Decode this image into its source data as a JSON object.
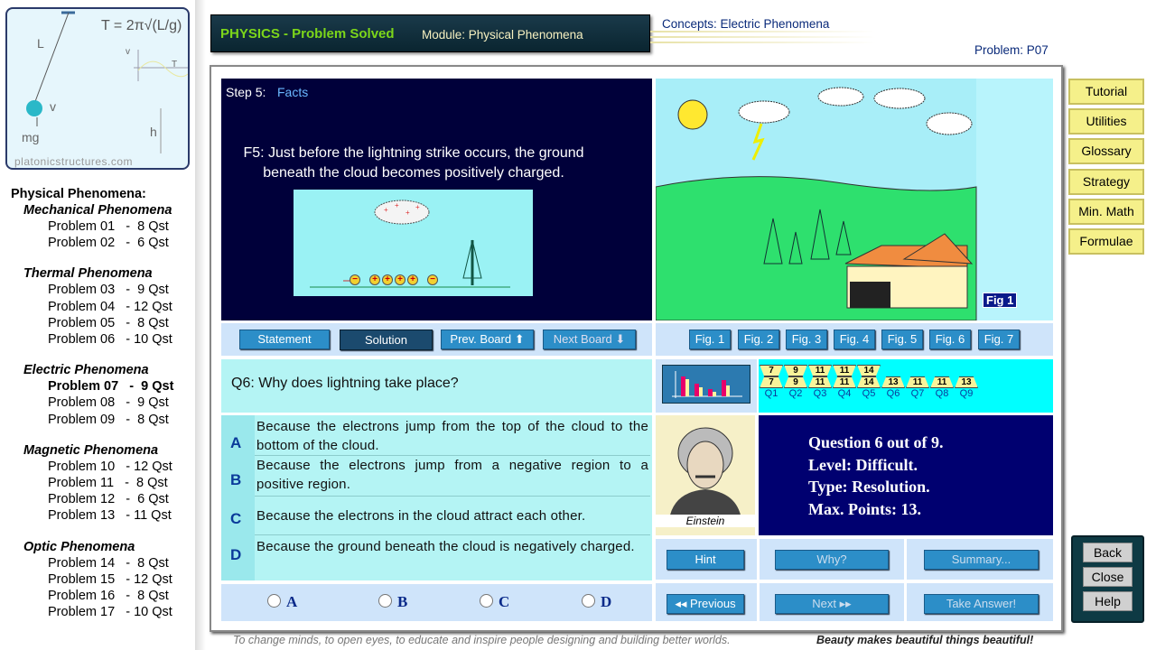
{
  "logo": {
    "formula": "T = 2π√(L/g)",
    "labels": [
      "L",
      "v",
      "mg",
      "h",
      "v",
      "T"
    ],
    "site": "platonicstructures.com"
  },
  "sidebar": {
    "title": "Physical Phenomena:",
    "groups": [
      {
        "name": "Mechanical Phenomena",
        "items": [
          "Problem 01   -  8 Qst",
          "Problem 02   -  6 Qst"
        ]
      },
      {
        "name": "Thermal Phenomena",
        "items": [
          "Problem 03   -  9 Qst",
          "Problem 04   - 12 Qst",
          "Problem 05   -  8 Qst",
          "Problem 06   - 10 Qst"
        ]
      },
      {
        "name": "Electric Phenomena",
        "items": [
          "Problem 07   -  9 Qst",
          "Problem 08   -  9 Qst",
          "Problem 09   -  8 Qst"
        ]
      },
      {
        "name": "Magnetic Phenomena",
        "items": [
          "Problem 10   - 12 Qst",
          "Problem 11   -  8 Qst",
          "Problem 12   -  6 Qst",
          "Problem 13   - 11 Qst"
        ]
      },
      {
        "name": "Optic Phenomena",
        "items": [
          "Problem 14   -  8 Qst",
          "Problem 15   - 12 Qst",
          "Problem 16   -  8 Qst",
          "Problem 17   - 10 Qst"
        ]
      }
    ],
    "current": "Problem 07"
  },
  "header": {
    "title": "PHYSICS - Problem Solved",
    "module": "Module: Physical Phenomena",
    "concepts": "Concepts: Electric Phenomena",
    "problem": "Problem: P07"
  },
  "board": {
    "step": "Step 5:",
    "step_name": "Facts",
    "fact": "F5: Just before the lightning strike occurs, the ground beneath the cloud becomes positively charged.",
    "charges": [
      "−",
      "+",
      "+",
      "+",
      "+",
      "−"
    ]
  },
  "figure": {
    "label": "Fig 1"
  },
  "board_buttons": [
    "Statement",
    "Solution",
    "Prev. Board ⬆",
    "Next Board ⬇"
  ],
  "fig_buttons": [
    "Fig. 1",
    "Fig. 2",
    "Fig. 3",
    "Fig. 4",
    "Fig. 5",
    "Fig. 6",
    "Fig. 7"
  ],
  "question": "Q6: Why does lightning take place?",
  "question_scores": [
    {
      "q": "Q1",
      "top": "7",
      "bottom": "7"
    },
    {
      "q": "Q2",
      "top": "9",
      "bottom": "9"
    },
    {
      "q": "Q3",
      "top": "11",
      "bottom": "11"
    },
    {
      "q": "Q4",
      "top": "11",
      "bottom": "11"
    },
    {
      "q": "Q5",
      "top": "14",
      "bottom": "14"
    },
    {
      "q": "Q6",
      "bottom": "13"
    },
    {
      "q": "Q7",
      "bottom": "11"
    },
    {
      "q": "Q8",
      "bottom": "11"
    },
    {
      "q": "Q9",
      "bottom": "13"
    }
  ],
  "answers": [
    {
      "letter": "A",
      "text": "Because the electrons jump from the top of the cloud to the bottom of the cloud."
    },
    {
      "letter": "B",
      "text": "Because the electrons jump from a negative region to a positive region."
    },
    {
      "letter": "C",
      "text": "Because the electrons in the cloud attract each other."
    },
    {
      "letter": "D",
      "text": "Because the ground beneath the cloud is negatively charged."
    }
  ],
  "radios": [
    "A",
    "B",
    "C",
    "D"
  ],
  "portrait": {
    "name": "Einstein"
  },
  "info": [
    "Question 6 out of 9.",
    "Level: Difficult.",
    "Type: Resolution.",
    "Max. Points: 13."
  ],
  "action_buttons": [
    "Hint",
    "Why?",
    "Summary...",
    "◂◂ Previous",
    "Next ▸▸",
    "Take Answer!"
  ],
  "side_buttons": [
    "Tutorial",
    "Utilities",
    "Glossary",
    "Strategy",
    "Min. Math",
    "Formulae"
  ],
  "system_buttons": [
    "Back",
    "Close",
    "Help"
  ],
  "footer": {
    "motto": "To change minds, to open eyes, to educate and inspire people designing and building better worlds.",
    "slogan": "Beauty makes beautiful things beautiful!"
  },
  "colors": {
    "navy": "#00003a",
    "cyan": "#00ffff",
    "button": "#2c8ec8",
    "side_button": "#f5f08a",
    "title_green": "#7cd61a"
  }
}
